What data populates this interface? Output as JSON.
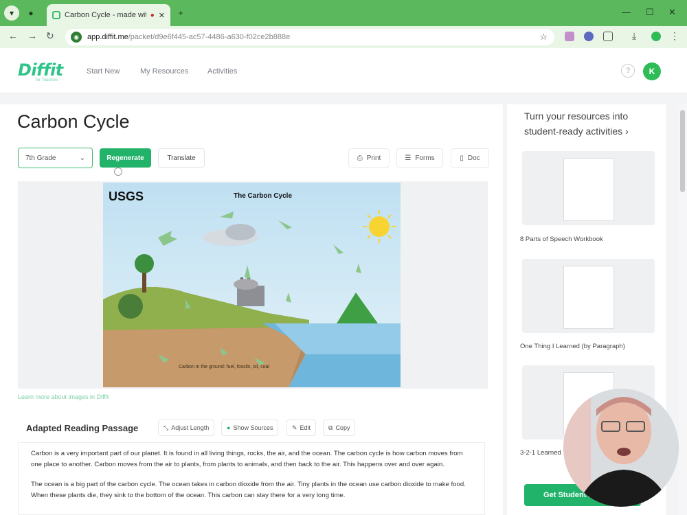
{
  "browser": {
    "tab_title": "Carbon Cycle - made with D",
    "url_host": "app.diffit.me",
    "url_path": "/packet/d9e6f445-ac57-4486-a630-f02ce2b888e",
    "new_tab": "+"
  },
  "app": {
    "logo": "Diffit",
    "logo_sub": "for Teachers",
    "nav": [
      "Start New",
      "My Resources",
      "Activities"
    ],
    "help": "?",
    "avatar": "K"
  },
  "page": {
    "title": "Carbon Cycle",
    "grade": "7th Grade",
    "regenerate": "Regenerate",
    "translate": "Translate",
    "print": "Print",
    "forms": "Forms",
    "doc": "Doc",
    "learn_more": "Learn more about images in Diffit"
  },
  "diagram": {
    "brand": "USGS",
    "title": "The Carbon Cycle",
    "caption": "Carbon in the ground: fuel, fossils, oil, coal"
  },
  "passage": {
    "title": "Adapted Reading Passage",
    "adjust": "Adjust Length",
    "sources": "Show Sources",
    "edit": "Edit",
    "copy": "Copy",
    "p1": "Carbon is a very important part of our planet. It is found in all living things, rocks, the air, and the ocean. The carbon cycle is how carbon moves from one place to another. Carbon moves from the air to plants, from plants to animals, and then back to the air. This happens over and over again.",
    "p2": "The ocean is a big part of the carbon cycle. The ocean takes in carbon dioxide from the air. Tiny plants in the ocean use carbon dioxide to make food. When these plants die, they sink to the bottom of the ocean. This carbon can stay there for a very long time."
  },
  "sidebar": {
    "heading": "Turn your resources into student-ready activities ›",
    "items": [
      "8 Parts of Speech Workbook",
      "One Thing I Learned (by Paragraph)",
      "3-2-1 Learned"
    ],
    "cta": "Get Student Activities"
  }
}
